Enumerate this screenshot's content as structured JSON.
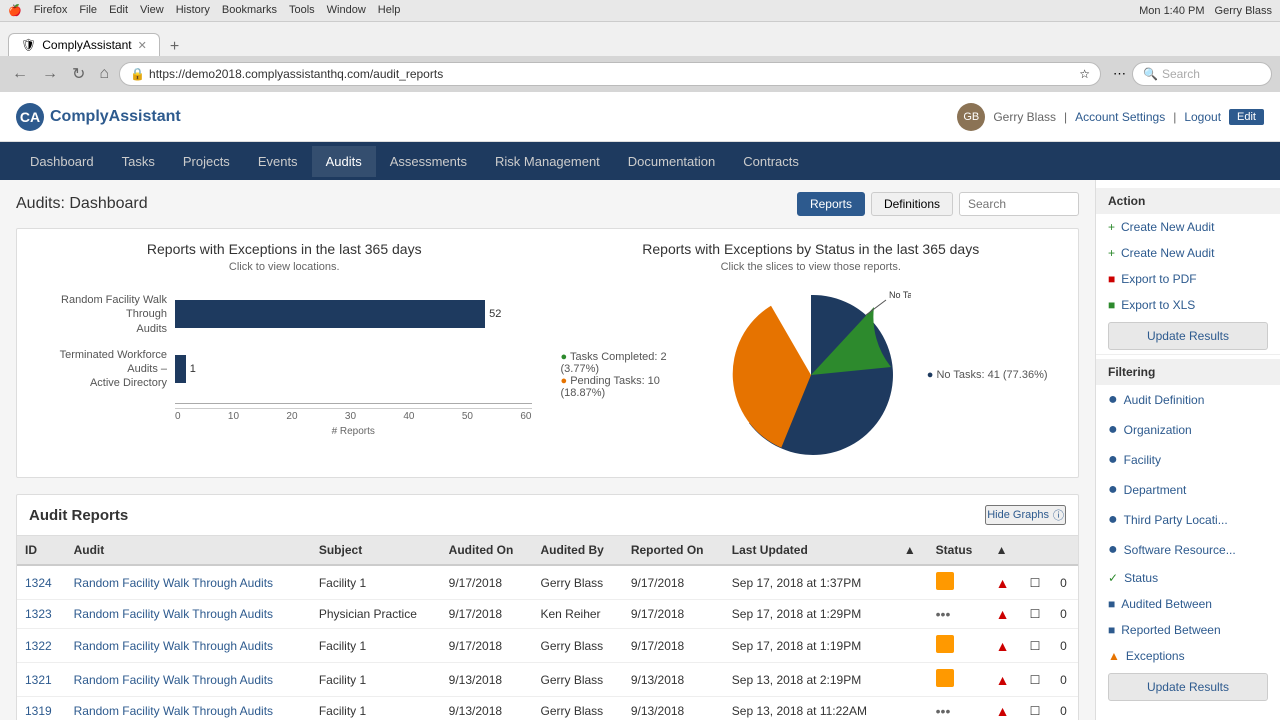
{
  "mac": {
    "menu_items": [
      "Firefox",
      "File",
      "Edit",
      "View",
      "History",
      "Bookmarks",
      "Tools",
      "Window",
      "Help"
    ],
    "time": "Mon 1:40 PM",
    "user": "Gerry Blass"
  },
  "browser": {
    "tab_title": "ComplyAssistant",
    "url": "https://demo2018.complyassistanthq.com/audit_reports",
    "search_placeholder": "Search"
  },
  "header": {
    "logo_text": "ComplyAssistant",
    "user_name": "Gerry Blass",
    "account_settings": "Account Settings",
    "logout": "Logout"
  },
  "nav": {
    "items": [
      "Dashboard",
      "Tasks",
      "Projects",
      "Events",
      "Audits",
      "Assessments",
      "Risk Management",
      "Documentation",
      "Contracts"
    ]
  },
  "page": {
    "title": "Audits: Dashboard",
    "reports_btn": "Reports",
    "definitions_btn": "Definitions",
    "search_placeholder": "Search"
  },
  "bar_chart": {
    "title": "Reports with Exceptions in the last 365 days",
    "subtitle": "Click to view locations.",
    "bars": [
      {
        "label": "Random Facility Walk Through Audits",
        "value": 52,
        "width_pct": 87
      },
      {
        "label": "Terminated Workforce Audits – Active Directory",
        "value": 1,
        "width_pct": 2
      }
    ],
    "axis_labels": [
      "0",
      "10",
      "20",
      "30",
      "40",
      "50",
      "60"
    ],
    "axis_title": "# Reports"
  },
  "pie_chart": {
    "title": "Reports with Exceptions by Status in the last 365 days",
    "subtitle": "Click the slices to view those reports.",
    "legend": [
      {
        "label": "Tasks Completed: 2 (3.77%)",
        "color": "#2d8a2d"
      },
      {
        "label": "Pending Tasks: 10 (18.87%)",
        "color": "#e67300"
      },
      {
        "label": "No Tasks: 41 (77.36%)",
        "color": "#1e3a5f"
      }
    ]
  },
  "reports_section": {
    "title": "Audit Reports",
    "hide_graphs_btn": "Hide Graphs",
    "columns": [
      "ID",
      "Audit",
      "Subject",
      "Audited On",
      "Audited By",
      "Reported On",
      "Last Updated",
      "",
      "Status",
      "▲",
      "",
      ""
    ],
    "rows": [
      {
        "id": "1324",
        "audit": "Random Facility Walk Through Audits",
        "subject": "Facility 1",
        "audited_on": "9/17/2018",
        "audited_by": "Gerry Blass",
        "reported_on": "9/17/2018",
        "last_updated": "Sep 17, 2018 at 1:37PM",
        "status_color": "orange",
        "has_warning": true
      },
      {
        "id": "1323",
        "audit": "Random Facility Walk Through Audits",
        "subject": "Physician Practice",
        "audited_on": "9/17/2018",
        "audited_by": "Ken Reiher",
        "reported_on": "9/17/2018",
        "last_updated": "Sep 17, 2018 at 1:29PM",
        "status_color": "none",
        "has_warning": true
      },
      {
        "id": "1322",
        "audit": "Random Facility Walk Through Audits",
        "subject": "Facility 1",
        "audited_on": "9/17/2018",
        "audited_by": "Gerry Blass",
        "reported_on": "9/17/2018",
        "last_updated": "Sep 17, 2018 at 1:19PM",
        "status_color": "orange",
        "has_warning": true
      },
      {
        "id": "1321",
        "audit": "Random Facility Walk Through Audits",
        "subject": "Facility 1",
        "audited_on": "9/13/2018",
        "audited_by": "Gerry Blass",
        "reported_on": "9/13/2018",
        "last_updated": "Sep 13, 2018 at 2:19PM",
        "status_color": "orange",
        "has_warning": true
      },
      {
        "id": "1319",
        "audit": "Random Facility Walk Through Audits",
        "subject": "Facility 1",
        "audited_on": "9/13/2018",
        "audited_by": "Gerry Blass",
        "reported_on": "9/13/2018",
        "last_updated": "Sep 13, 2018 at 11:22AM",
        "status_color": "none",
        "has_warning": true
      }
    ]
  },
  "sidebar": {
    "action_title": "Action",
    "actions": [
      {
        "label": "Create New Audit",
        "icon": "+",
        "color": "green"
      },
      {
        "label": "Create New Audit",
        "icon": "+",
        "color": "green"
      },
      {
        "label": "Export to PDF",
        "icon": "■",
        "color": "red"
      },
      {
        "label": "Export to XLS",
        "icon": "■",
        "color": "green"
      },
      {
        "label": "Update Results",
        "color": "blue",
        "type": "btn"
      }
    ],
    "filter_title": "Filtering",
    "filters": [
      {
        "label": "Audit Definition",
        "icon": "●",
        "color": "blue"
      },
      {
        "label": "Organization",
        "icon": "●",
        "color": "blue"
      },
      {
        "label": "Facility",
        "icon": "●",
        "color": "blue"
      },
      {
        "label": "Department",
        "icon": "●",
        "color": "blue"
      },
      {
        "label": "Third Party Locati...",
        "icon": "●",
        "color": "blue"
      },
      {
        "label": "Software Resource...",
        "icon": "●",
        "color": "blue"
      },
      {
        "label": "Status",
        "icon": "✓",
        "color": "green"
      },
      {
        "label": "Audited Between",
        "icon": "■",
        "color": "blue"
      },
      {
        "label": "Reported Between",
        "icon": "■",
        "color": "blue"
      },
      {
        "label": "Exceptions",
        "icon": "▲",
        "color": "orange"
      }
    ],
    "update_results": "Update Results"
  }
}
